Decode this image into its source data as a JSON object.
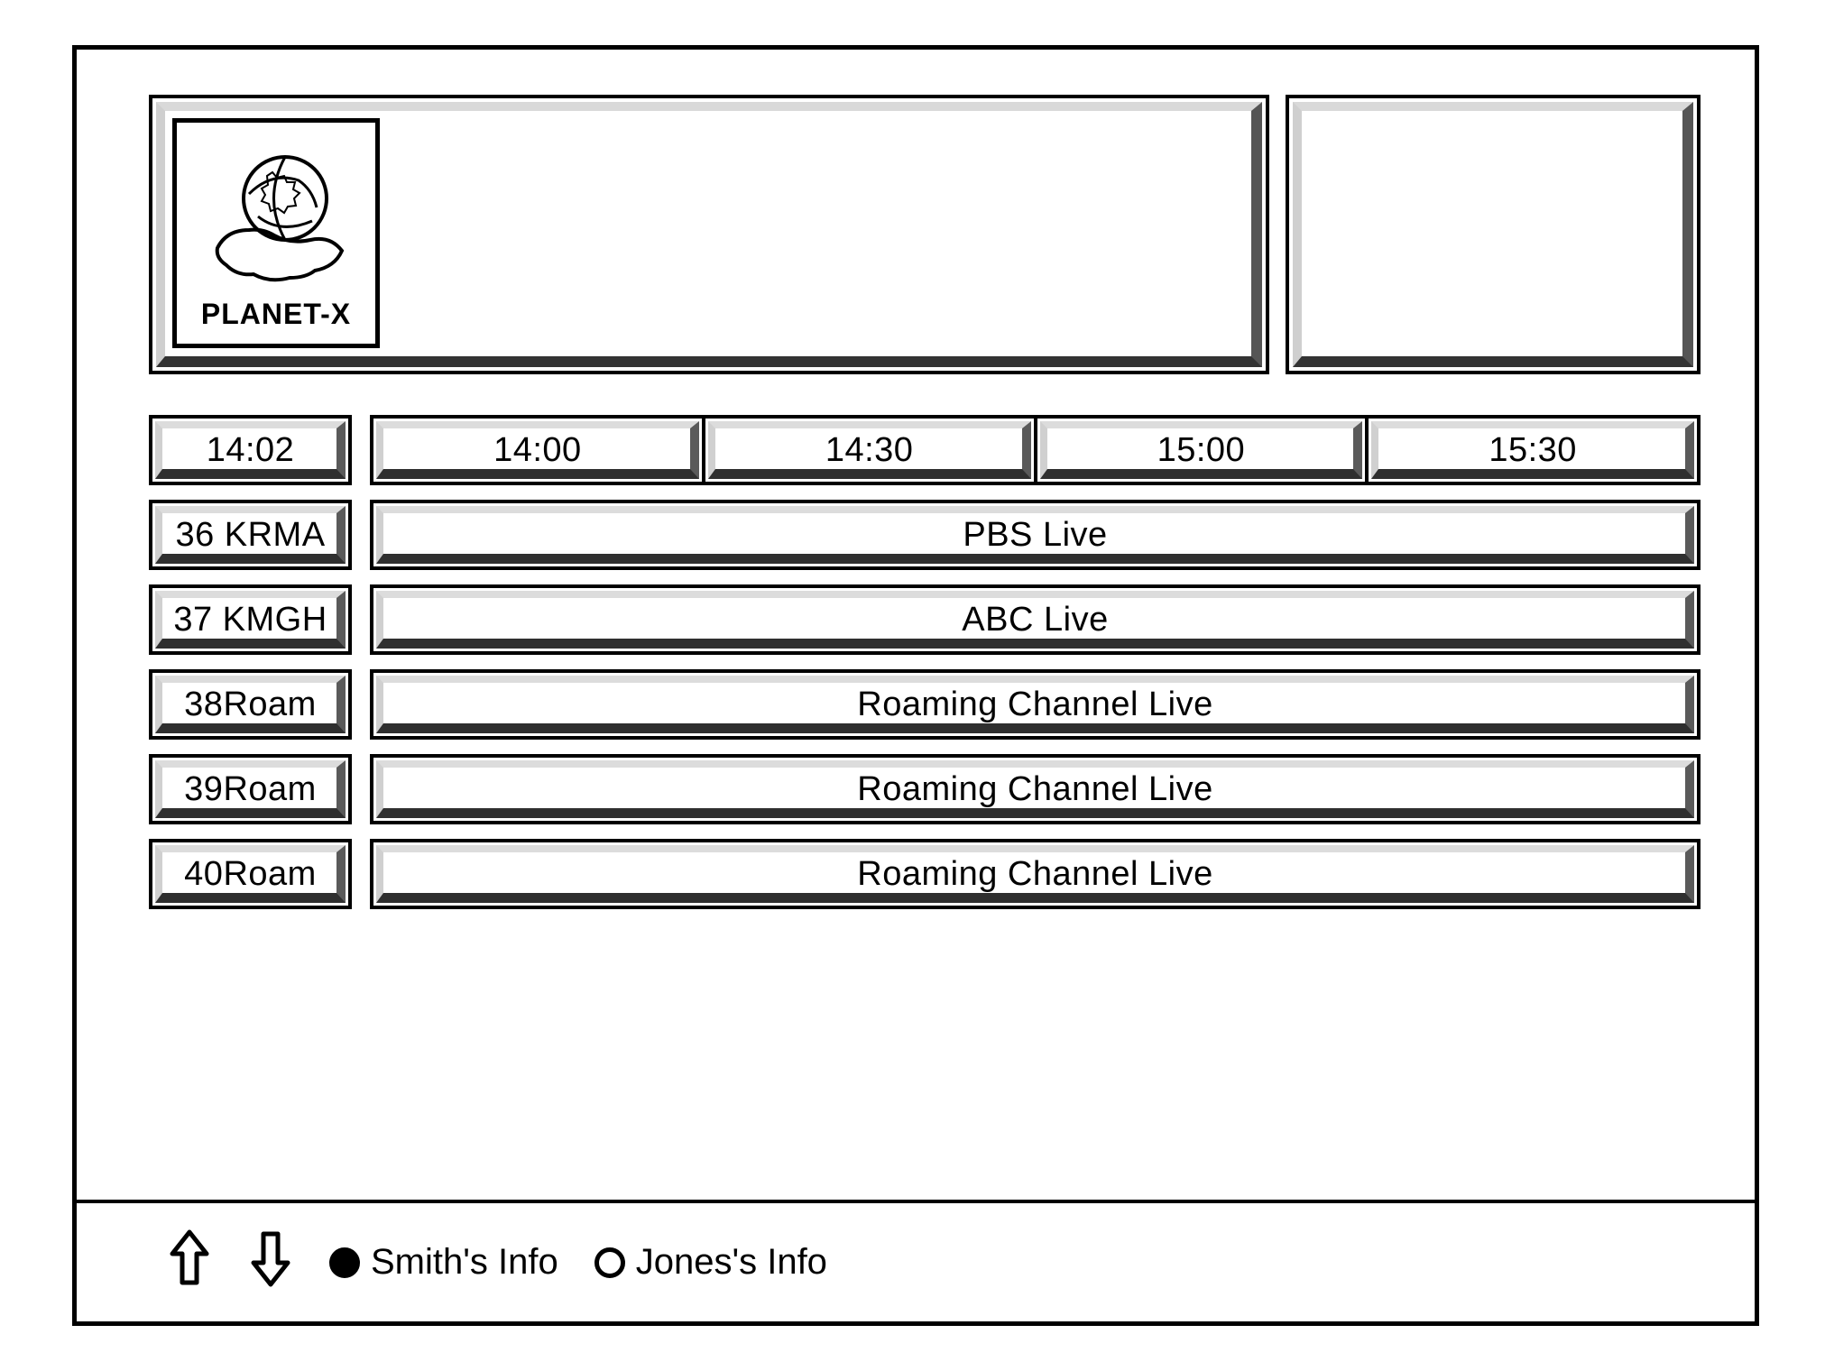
{
  "header": {
    "logo_label": "PLANET-X"
  },
  "guide": {
    "current_time": "14:02",
    "time_slots": [
      "14:00",
      "14:30",
      "15:00",
      "15:30"
    ],
    "rows": [
      {
        "channel": "36 KRMA",
        "program": "PBS Live"
      },
      {
        "channel": "37 KMGH",
        "program": "ABC Live"
      },
      {
        "channel": "38Roam",
        "program": "Roaming Channel Live"
      },
      {
        "channel": "39Roam",
        "program": "Roaming Channel Live"
      },
      {
        "channel": "40Roam",
        "program": "Roaming Channel Live"
      }
    ]
  },
  "footer": {
    "option_a": "Smith's Info",
    "option_b": "Jones's Info",
    "selected": "a"
  }
}
